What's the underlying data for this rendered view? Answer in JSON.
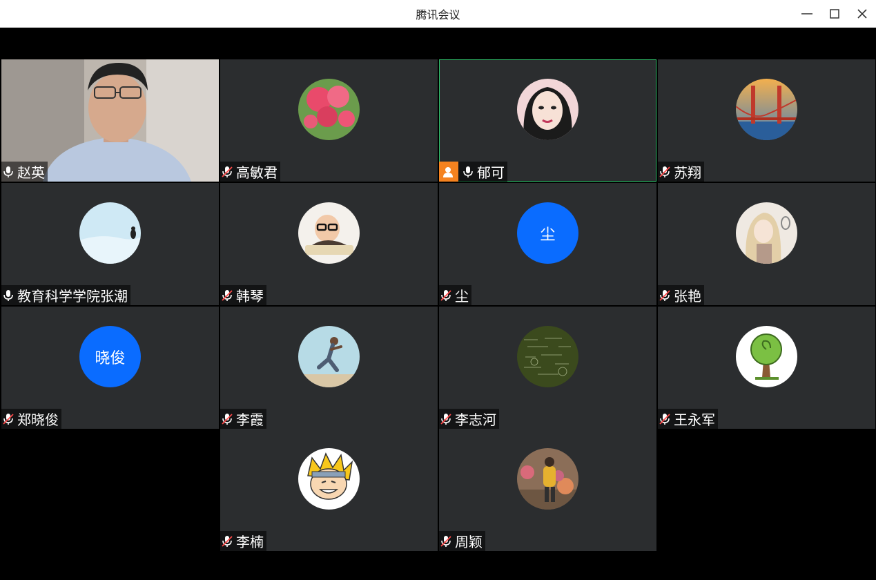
{
  "window": {
    "title": "腾讯会议",
    "controls": {
      "minimize": "minimize-icon",
      "maximize": "maximize-icon",
      "close": "close-icon"
    }
  },
  "colors": {
    "tile_bg": "#2b2d2f",
    "active_border": "#2fbf6a",
    "host_badge": "#f5821f",
    "text_avatar_bg": "#0a6cff"
  },
  "participants": [
    {
      "name": "赵英",
      "mic": "on",
      "avatar": "camera-video"
    },
    {
      "name": "高敏君",
      "mic": "muted",
      "avatar": "tulip-photo"
    },
    {
      "name": "郁可",
      "mic": "on",
      "avatar": "woman-portrait",
      "host": true,
      "active": true
    },
    {
      "name": "苏翔",
      "mic": "muted",
      "avatar": "bridge-photo"
    },
    {
      "name": "教育科学学院张潮",
      "mic": "on",
      "avatar": "penguin-snow"
    },
    {
      "name": "韩琴",
      "mic": "muted",
      "avatar": "baby-glasses"
    },
    {
      "name": "尘",
      "mic": "muted",
      "avatar_text": "尘"
    },
    {
      "name": "张艳",
      "mic": "muted",
      "avatar": "anime-girl"
    },
    {
      "name": "郑晓俊",
      "mic": "muted",
      "avatar_text": "晓俊"
    },
    {
      "name": "李霞",
      "mic": "muted",
      "avatar": "jumping-man"
    },
    {
      "name": "李志河",
      "mic": "muted",
      "avatar": "formula-chalkboard"
    },
    {
      "name": "王永军",
      "mic": "muted",
      "avatar": "tree-cartoon"
    },
    {
      "name": "李楠",
      "mic": "muted",
      "avatar": "naruto-cartoon"
    },
    {
      "name": "周颖",
      "mic": "muted",
      "avatar": "flower-shop-photo"
    }
  ]
}
